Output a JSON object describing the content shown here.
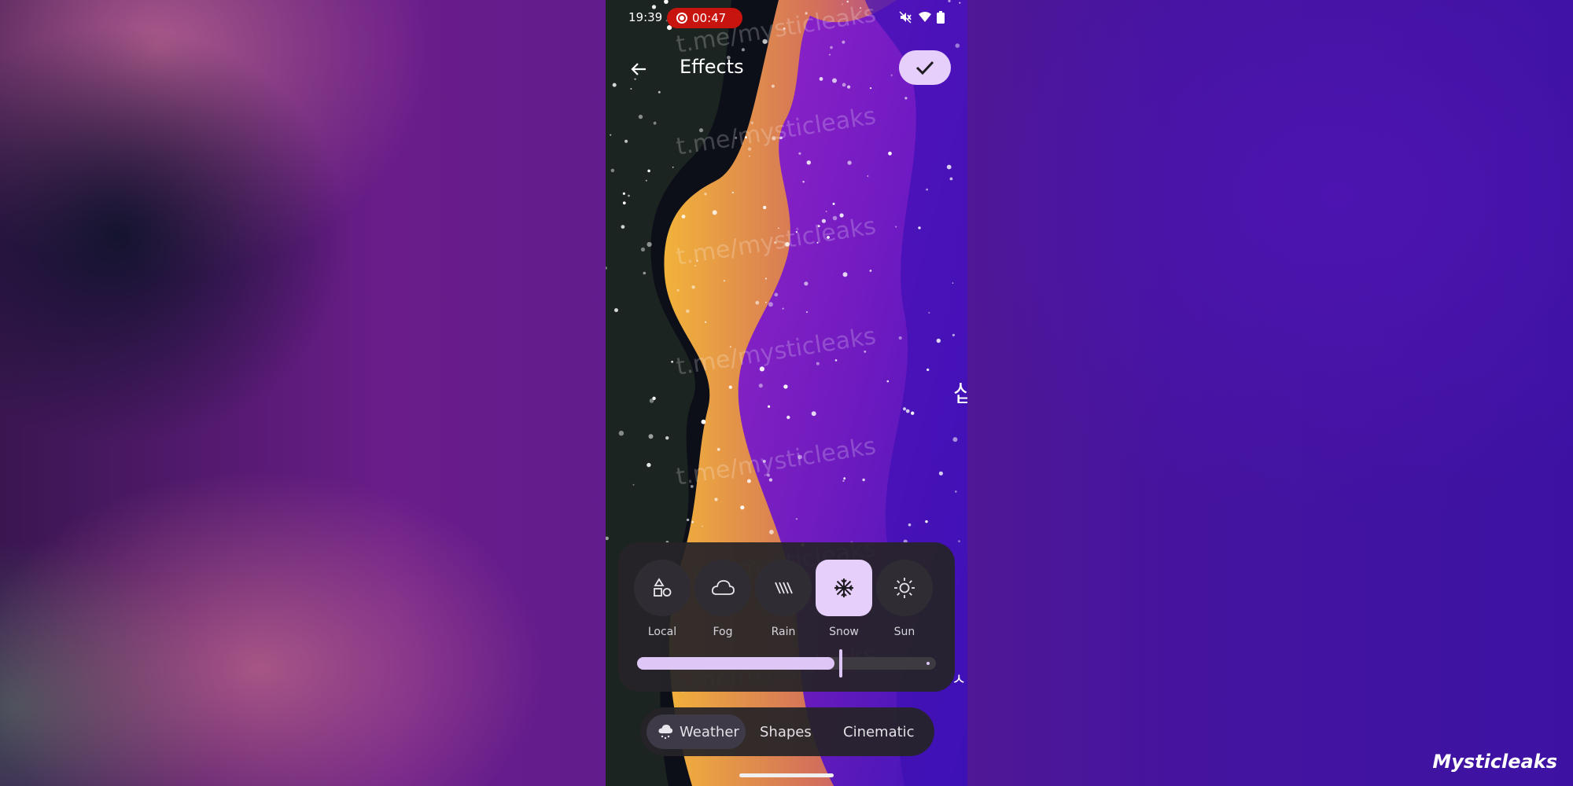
{
  "status_bar": {
    "time": "19:39",
    "recording_time": "00:47",
    "icons": [
      "recording-icon",
      "mute-icon",
      "wifi-icon",
      "battery-icon"
    ]
  },
  "header": {
    "title": "Effects",
    "back_icon": "arrow-back-icon",
    "confirm_icon": "check-icon"
  },
  "watermark": {
    "text": "t.me/mysticleaks"
  },
  "side_glyphs": [
    "삽",
    "ㅅ"
  ],
  "effects": {
    "items": [
      {
        "label": "Local",
        "icon": "shapes-icon",
        "selected": false
      },
      {
        "label": "Fog",
        "icon": "cloud-icon",
        "selected": false
      },
      {
        "label": "Rain",
        "icon": "rain-icon",
        "selected": false
      },
      {
        "label": "Snow",
        "icon": "snowflake-icon",
        "selected": true
      },
      {
        "label": "Sun",
        "icon": "sun-icon",
        "selected": false
      }
    ],
    "intensity": 0.66
  },
  "tabs": [
    {
      "label": "Weather",
      "icon": "weather-icon",
      "selected": true
    },
    {
      "label": "Shapes",
      "selected": false
    },
    {
      "label": "Cinematic",
      "selected": false
    }
  ],
  "brand": "Mysticleaks",
  "colors": {
    "accent": "#e6cffb",
    "recording": "#c8140f",
    "panel": "#262428"
  }
}
